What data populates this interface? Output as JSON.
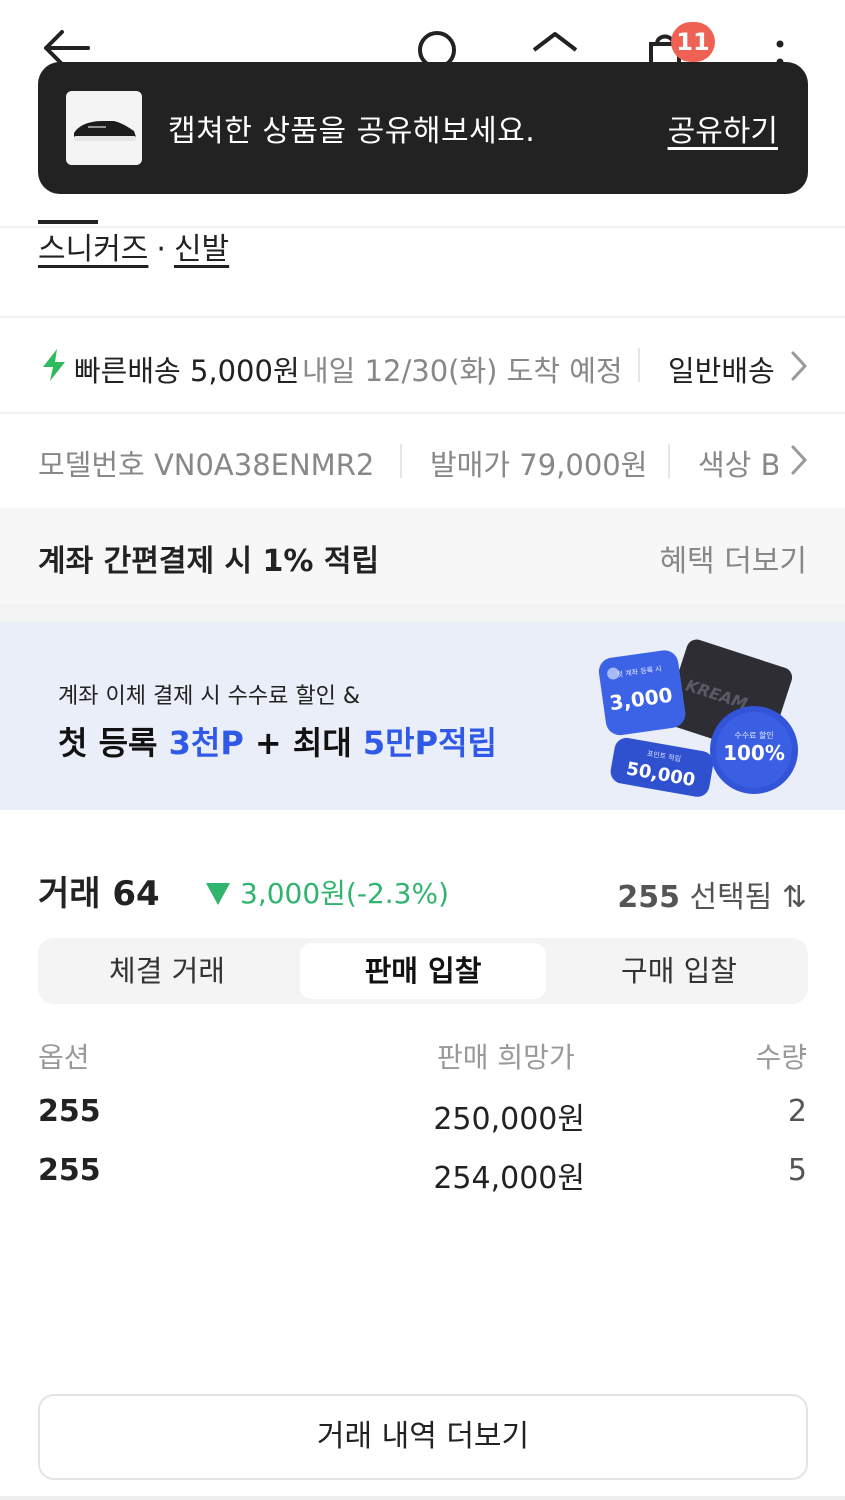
{
  "toast": {
    "message": "캡쳐한 상품을 공유해보세요.",
    "action": "공유하기"
  },
  "nav": {
    "cart_count": "11"
  },
  "category": {
    "primary": "스니커즈",
    "separator": "·",
    "secondary": "신발"
  },
  "delivery": {
    "fast_label": "빠른배송 5,000원",
    "fast_date": "내일 12/30(화) 도착 예정",
    "normal_label": "일반배송"
  },
  "info": {
    "model": "모델번호 VN0A38ENMR2",
    "release_price": "발매가 79,000원",
    "color": "색상 B"
  },
  "benefit": {
    "text": "계좌 간편결제 시 1% 적립",
    "more": "혜택 더보기"
  },
  "banner": {
    "subtitle": "계좌 이체 결제 시 수수료 할인 &",
    "title_prefix": "첫 등록 ",
    "title_hl1": "3천P",
    "title_mid": " + 최대 ",
    "title_hl2": "5만P적립",
    "card1_small": "첫 계좌 등록 시",
    "card1_value": "3,000",
    "card2_small": "포인트 적립",
    "card2_value": "50,000",
    "card3_small": "수수료 할인",
    "card3_value": "100%",
    "box_logo": "KREAM"
  },
  "trade": {
    "title": "거래 64",
    "change": "3,000원(-2.3%)",
    "size_value": "255",
    "size_label": " 선택됨",
    "sort_icon": "⇅"
  },
  "tabs": [
    {
      "label": "체결 거래",
      "active": false
    },
    {
      "label": "판매 입찰",
      "active": true
    },
    {
      "label": "구매 입찰",
      "active": false
    }
  ],
  "table": {
    "headers": [
      "옵션",
      "판매 희망가",
      "수량"
    ],
    "rows": [
      {
        "option": "255",
        "price": "250,000원",
        "qty": "2"
      },
      {
        "option": "255",
        "price": "254,000원",
        "qty": "5"
      }
    ]
  },
  "more_button": "거래 내역 더보기",
  "colors": {
    "toast_bg": "#222222",
    "badge": "#ef6253",
    "accent_blue": "#2f59e6",
    "down_green": "#31b46e",
    "banner_bg": "#e9eef9"
  }
}
